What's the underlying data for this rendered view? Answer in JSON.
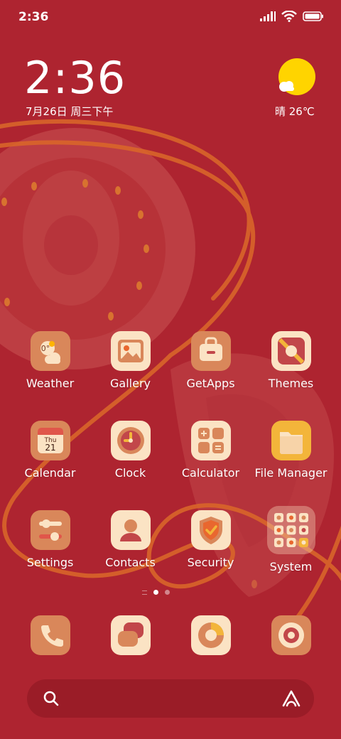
{
  "status": {
    "time": "2:36"
  },
  "clock": {
    "time": "2:36",
    "date": "7月26日 周三下午"
  },
  "weather": {
    "text": "晴 26℃"
  },
  "apps": [
    {
      "label": "Weather",
      "icon": "weather-icon"
    },
    {
      "label": "Gallery",
      "icon": "gallery-icon"
    },
    {
      "label": "GetApps",
      "icon": "getapps-icon"
    },
    {
      "label": "Themes",
      "icon": "themes-icon"
    },
    {
      "label": "Calendar",
      "icon": "calendar-icon",
      "day": "Thu",
      "date": "21"
    },
    {
      "label": "Clock",
      "icon": "clock-icon"
    },
    {
      "label": "Calculator",
      "icon": "calculator-icon"
    },
    {
      "label": "File Manager",
      "icon": "file-manager-icon"
    },
    {
      "label": "Settings",
      "icon": "settings-icon"
    },
    {
      "label": "Contacts",
      "icon": "contacts-icon"
    },
    {
      "label": "Security",
      "icon": "security-icon"
    },
    {
      "label": "System",
      "icon": "system-folder-icon"
    }
  ],
  "weather_widget_icon_temp": "0°",
  "dock": [
    {
      "icon": "phone-icon"
    },
    {
      "icon": "messages-icon"
    },
    {
      "icon": "browser-icon"
    },
    {
      "icon": "camera-icon"
    }
  ],
  "colors": {
    "background": "#ae2430",
    "icon_cream": "#fbe3c4",
    "icon_tan": "#d9875a",
    "accent_orange": "#e9672f",
    "sun": "#ffd400"
  }
}
